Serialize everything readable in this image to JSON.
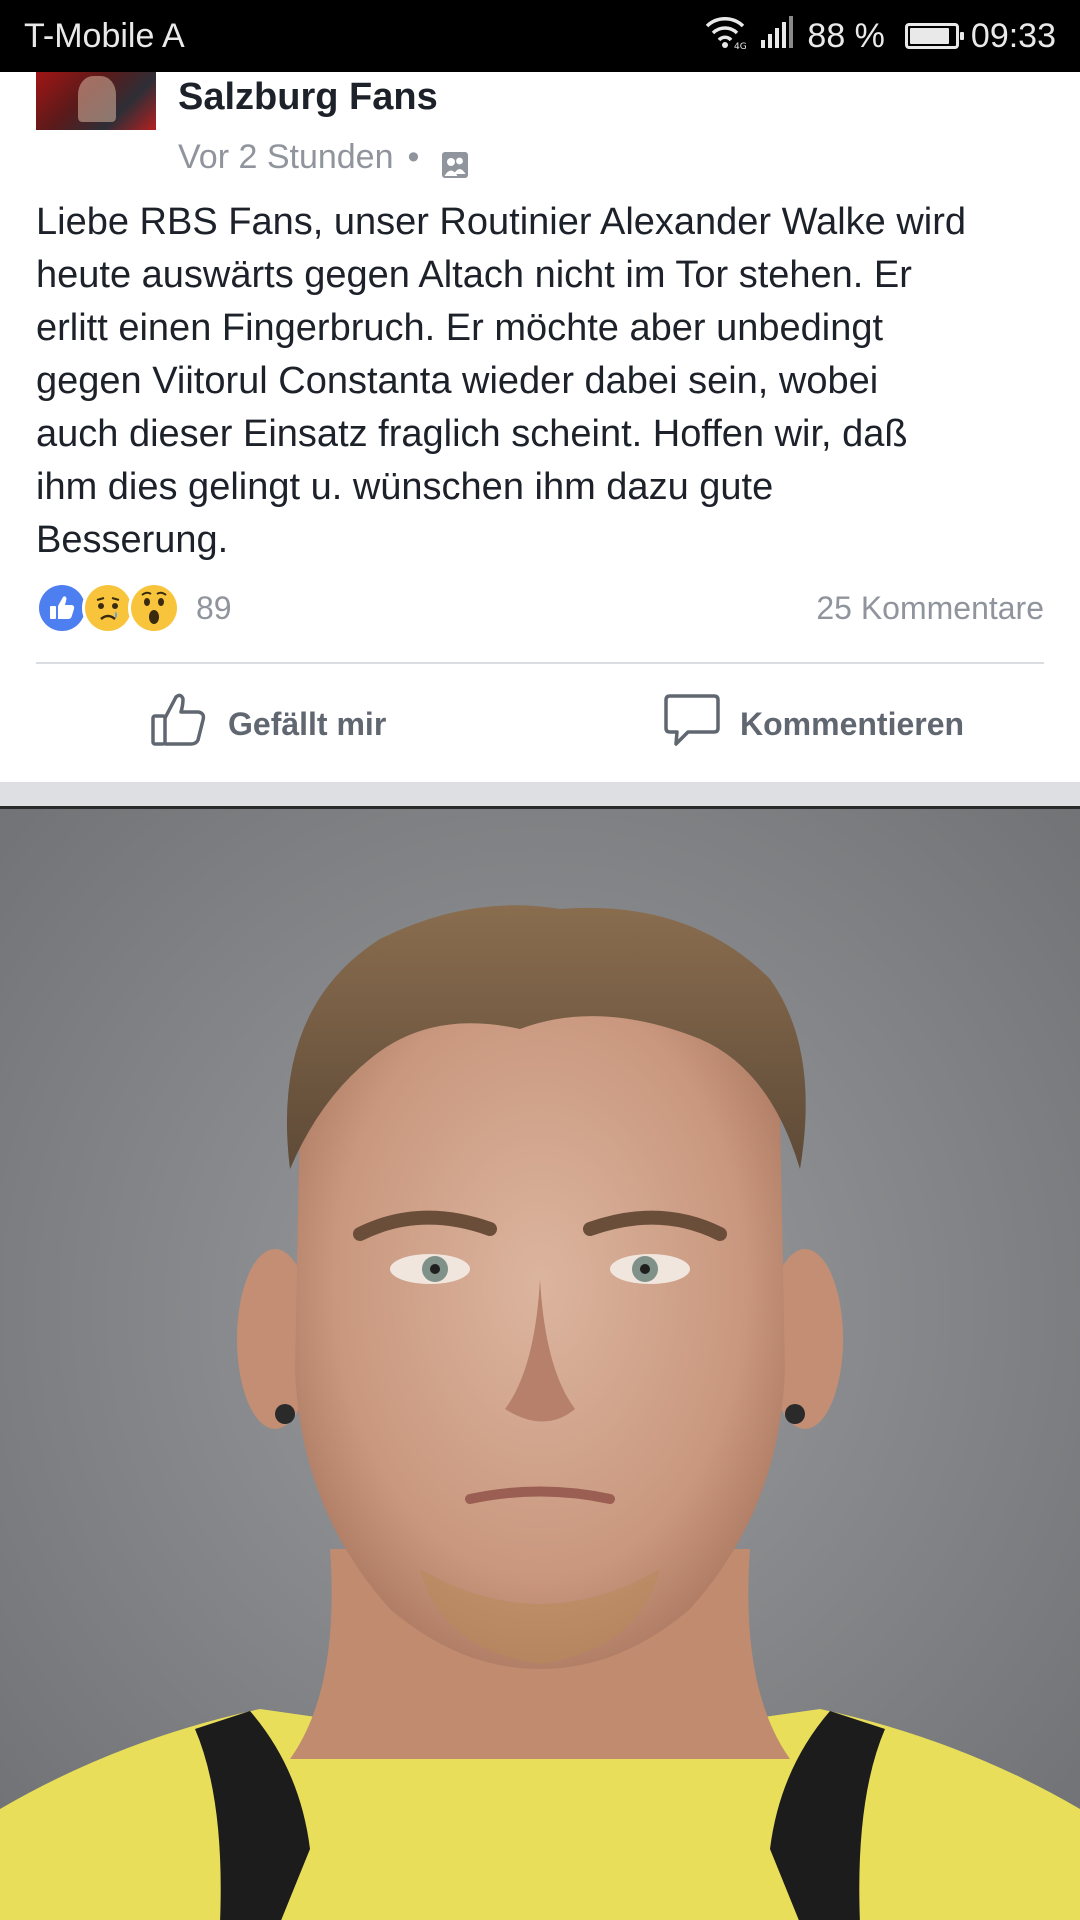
{
  "status_bar": {
    "carrier": "T-Mobile A",
    "battery_percent": "88 %",
    "battery_level": 0.88,
    "time": "09:33"
  },
  "post": {
    "page_name": "Salzburg Fans",
    "timestamp": "Vor 2 Stunden",
    "separator": "•",
    "text": "Liebe RBS Fans, unser Routinier Alexander Walke wird\nheute auswärts gegen Altach nicht im Tor stehen. Er\nerlitt einen Fingerbruch. Er möchte aber unbedingt\ngegen Viitorul Constanta wieder dabei sein, wobei\nauch dieser Einsatz fraglich scheint. Hoffen wir, daß\nihm dies gelingt u. wünschen ihm dazu gute\nBesserung.",
    "reactions": {
      "icons": [
        "like-reaction-icon",
        "sad-reaction-icon",
        "wow-reaction-icon"
      ],
      "count": "89"
    },
    "comments_label": "25 Kommentare",
    "actions": {
      "like_label": "Gefällt mir",
      "comment_label": "Kommentieren"
    }
  },
  "colors": {
    "like_blue": "#4267b2",
    "reaction_yellow": "#f7c43b",
    "meta_gray": "#90949c",
    "action_gray": "#606770"
  }
}
